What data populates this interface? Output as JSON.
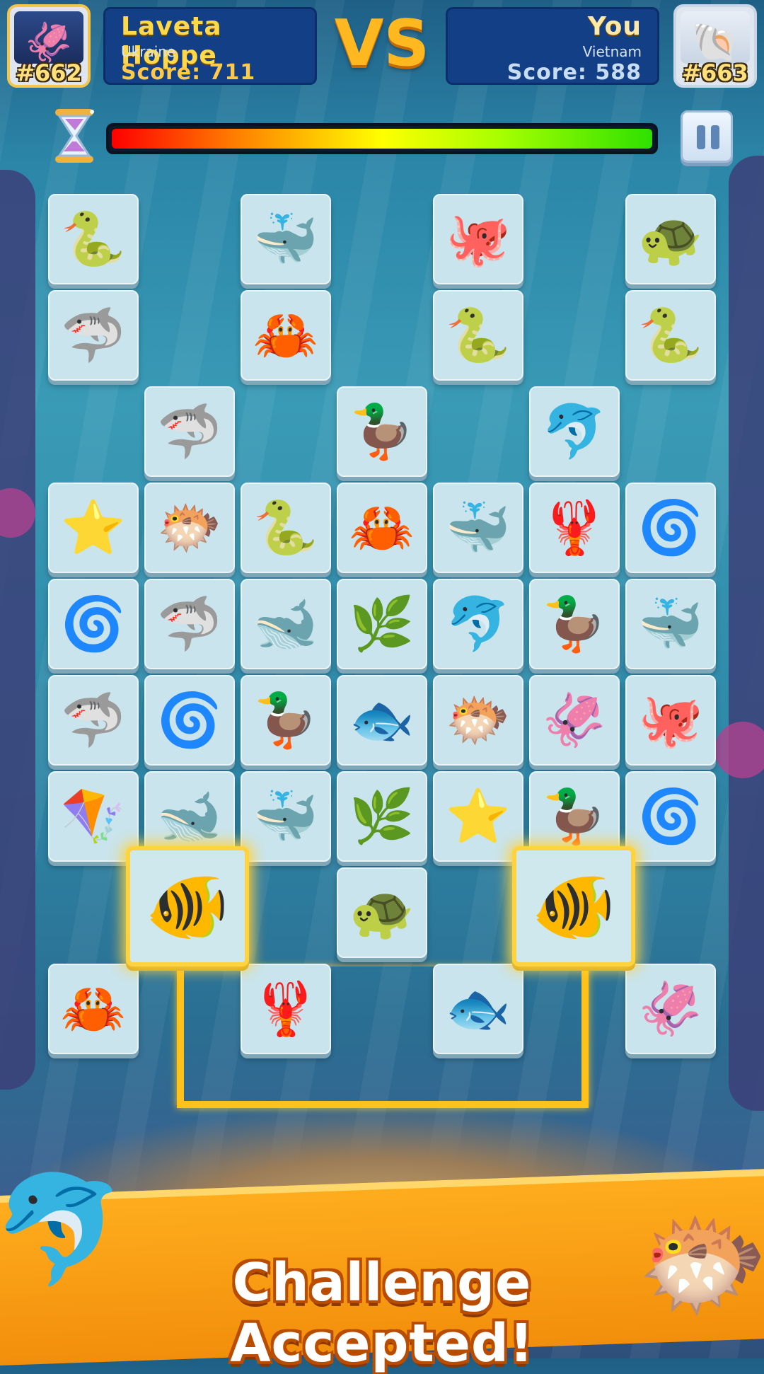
{
  "player_left": {
    "name": "Laveta Hoppe",
    "country": "Ukraine",
    "score": "Score: 711",
    "rank": "#662",
    "avatar_icon": "squid-icon"
  },
  "vs_label": "VS",
  "player_right": {
    "name": "You",
    "country": "Vietnam",
    "score": "Score: 588",
    "rank": "#663",
    "avatar_icon": "hermit-crab-icon"
  },
  "timer": {
    "remaining_fraction": 1.0
  },
  "banner": {
    "text": "Challenge Accepted!"
  },
  "tile_types": {
    "eel": "🐍",
    "whale": "🐳",
    "octopus": "🐙",
    "turtle": "🐢",
    "shark": "🦈",
    "crab": "🦀",
    "duck": "🦆",
    "dolphin": "🐬",
    "starfish": "⭐",
    "pufferfish": "🐡",
    "lobster": "🦞",
    "seahorse": "🌀",
    "blue-whale": "🐋",
    "seaweed": "🌿",
    "fish": "🐟",
    "stingray": "🪁",
    "squid": "🦑",
    "piranha": "🐠"
  },
  "board": {
    "rows": [
      [
        "eel",
        null,
        "whale",
        null,
        "octopus",
        null,
        "turtle"
      ],
      [
        "shark",
        null,
        "crab",
        null,
        "eel",
        null,
        "eel"
      ],
      [
        null,
        "shark",
        null,
        "duck",
        null,
        "dolphin",
        null
      ],
      [
        "starfish",
        "pufferfish",
        "eel",
        "crab",
        "whale",
        "lobster",
        "seahorse"
      ],
      [
        "seahorse",
        "shark",
        "blue-whale",
        "seaweed",
        "dolphin",
        "duck",
        "whale"
      ],
      [
        "shark",
        "seahorse",
        "duck",
        "fish",
        "pufferfish",
        "squid",
        "octopus"
      ],
      [
        "stingray",
        "blue-whale",
        "whale",
        "seaweed",
        "starfish",
        "duck",
        "seahorse"
      ],
      [
        null,
        null,
        null,
        "turtle",
        null,
        null,
        null
      ],
      [
        "crab",
        null,
        "lobster",
        null,
        "fish",
        null,
        "squid"
      ]
    ],
    "selected": [
      {
        "type": "piranha",
        "label": "selected-piranha-left"
      },
      {
        "type": "piranha",
        "label": "selected-piranha-right"
      }
    ]
  },
  "colors": {
    "banner": "#f7a21a",
    "path": "#ffc21a",
    "score_left": "#ffc94a",
    "panel": "#123f86"
  }
}
